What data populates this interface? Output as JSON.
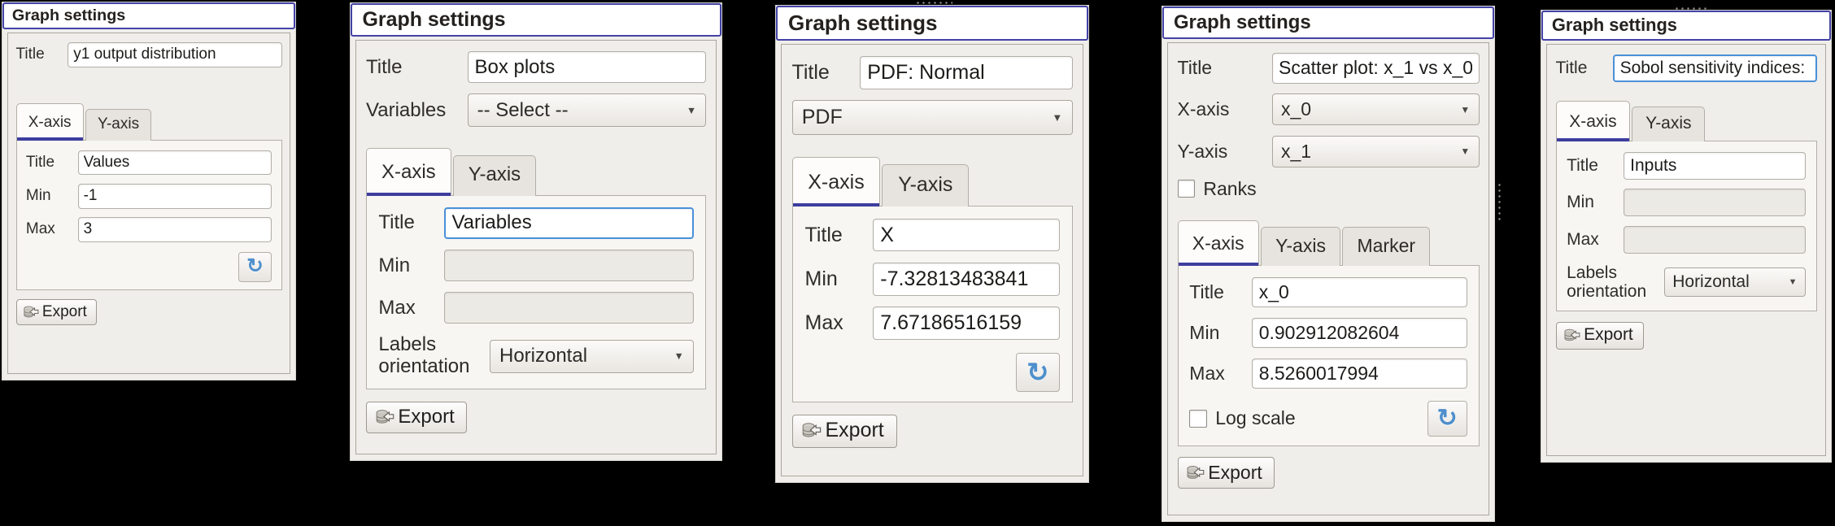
{
  "colors": {
    "accent_border": "#4343a6",
    "tab_underline": "#3e3d9e",
    "focus_blue": "#4a90d9",
    "refresh_blue": "#4e8fcc",
    "panel_bg": "#f0eeea"
  },
  "icons": {
    "dropdown_glyph": "▼",
    "refresh_glyph": "↻"
  },
  "panels": [
    {
      "header": "Graph settings",
      "fields": {
        "title_label": "Title",
        "title_value": "y1 output distribution"
      },
      "tabs": {
        "x": "X-axis",
        "y": "Y-axis"
      },
      "axis_box": {
        "title_label": "Title",
        "title_value": "Values",
        "min_label": "Min",
        "min_value": "-1",
        "max_label": "Max",
        "max_value": "3"
      },
      "export_label": "Export"
    },
    {
      "header": "Graph settings",
      "fields": {
        "title_label": "Title",
        "title_value": "Box plots",
        "variables_label": "Variables",
        "variables_value": "-- Select --"
      },
      "tabs": {
        "x": "X-axis",
        "y": "Y-axis"
      },
      "axis_box": {
        "title_label": "Title",
        "title_value": "Variables",
        "min_label": "Min",
        "min_value": "",
        "max_label": "Max",
        "max_value": "",
        "labels_orientation_label": "Labels orientation",
        "labels_orientation_value": "Horizontal"
      },
      "export_label": "Export"
    },
    {
      "header": "Graph settings",
      "fields": {
        "title_label": "Title",
        "title_value": "PDF: Normal",
        "plot_type_value": "PDF"
      },
      "tabs": {
        "x": "X-axis",
        "y": "Y-axis"
      },
      "axis_box": {
        "title_label": "Title",
        "title_value": "X",
        "min_label": "Min",
        "min_value": "-7.32813483841",
        "max_label": "Max",
        "max_value": "7.67186516159"
      },
      "export_label": "Export"
    },
    {
      "header": "Graph settings",
      "fields": {
        "title_label": "Title",
        "title_value": "Scatter plot: x_1 vs x_0",
        "xaxis_label": "X-axis",
        "xaxis_value": "x_0",
        "yaxis_label": "Y-axis",
        "yaxis_value": "x_1",
        "ranks_label": "Ranks"
      },
      "tabs": {
        "x": "X-axis",
        "y": "Y-axis",
        "marker": "Marker"
      },
      "axis_box": {
        "title_label": "Title",
        "title_value": "x_0",
        "min_label": "Min",
        "min_value": "0.902912082604",
        "max_label": "Max",
        "max_value": "8.5260017994",
        "log_scale_label": "Log scale"
      },
      "export_label": "Export"
    },
    {
      "header": "Graph settings",
      "fields": {
        "title_label": "Title",
        "title_value": "Sobol sensitivity indices:"
      },
      "tabs": {
        "x": "X-axis",
        "y": "Y-axis"
      },
      "axis_box": {
        "title_label": "Title",
        "title_value": "Inputs",
        "min_label": "Min",
        "min_value": "",
        "max_label": "Max",
        "max_value": "",
        "labels_orientation_label": "Labels orientation",
        "labels_orientation_value": "Horizontal"
      },
      "export_label": "Export"
    }
  ]
}
